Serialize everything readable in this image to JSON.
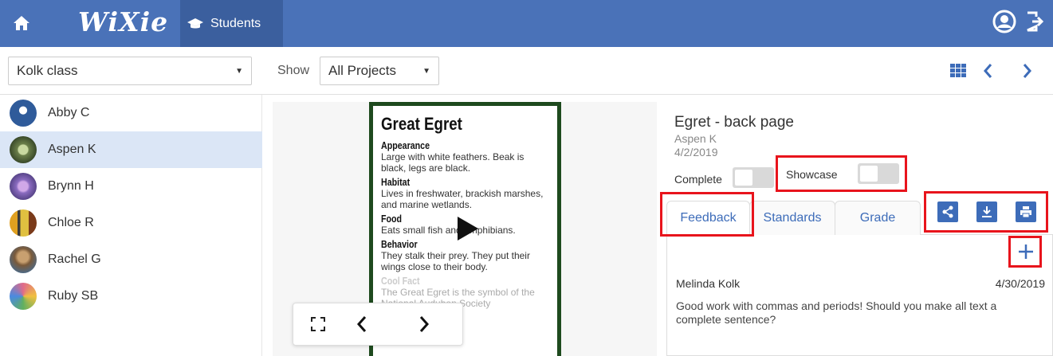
{
  "header": {
    "logo": "WiXie",
    "students_tab": "Students"
  },
  "toolbar": {
    "class_select": "Kolk class",
    "show_label": "Show",
    "projects_select": "All Projects"
  },
  "students": [
    {
      "name": "Abby C",
      "color": "#2f5b9a"
    },
    {
      "name": "Aspen K",
      "color": "#6b7f4a"
    },
    {
      "name": "Brynn H",
      "color": "#8a6bbf"
    },
    {
      "name": "Chloe R",
      "color": "#e0a020"
    },
    {
      "name": "Rachel G",
      "color": "#7a5a3a"
    },
    {
      "name": "Ruby SB",
      "color": "#e06a8a"
    }
  ],
  "active_student": "Aspen K",
  "preview": {
    "title": "Great Egret",
    "sections": [
      {
        "head": "Appearance",
        "body": "Large with white feathers. Beak is black, legs are black."
      },
      {
        "head": "Habitat",
        "body": "Lives in freshwater, brackish marshes, and marine wetlands."
      },
      {
        "head": "Food",
        "body": "Eats small fish and amphibians."
      },
      {
        "head": "Behavior",
        "body": "They stalk their prey. They put their wings close to their body."
      },
      {
        "head": "Cool Fact",
        "body": "The Great Egret is the symbol of the National Audubon Society"
      }
    ]
  },
  "details": {
    "title": "Egret - back page",
    "author": "Aspen K",
    "date": "4/2/2019",
    "complete_label": "Complete",
    "showcase_label": "Showcase",
    "tabs": {
      "feedback": "Feedback",
      "standards": "Standards",
      "grade": "Grade"
    },
    "feedback": {
      "author": "Melinda Kolk",
      "date": "4/30/2019",
      "text": "Good work with commas and periods! Should you make all text a complete sentence?"
    }
  },
  "colors": {
    "header": "#4a72b8",
    "accent": "#3d6cb9",
    "highlight": "#e8141c"
  }
}
